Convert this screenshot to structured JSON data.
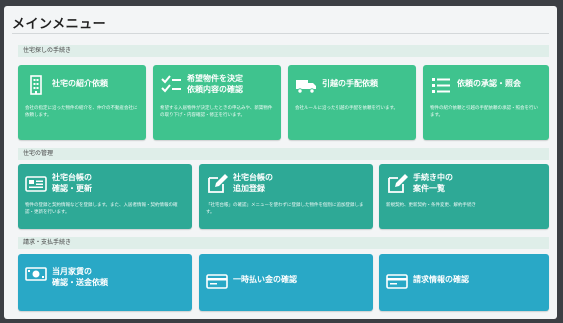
{
  "page": {
    "title": "メインメニュー"
  },
  "sections": [
    {
      "header": "住宅探しの手続き",
      "cards": [
        {
          "title": "社宅の紹介依頼",
          "description": "会社の指定に沿った物件の紹介を、仲介の不動産会社に依頼します。",
          "icon": "building-icon"
        },
        {
          "title": "希望物件を決定\n依頼内容の確認",
          "description": "希望する入居物件が決定したときの申込みや、新築物件の取り下げ・内容確認・修正を行います。",
          "icon": "checklist-icon"
        },
        {
          "title": "引越の手配依頼",
          "description": "会社ルールに沿った引越の手配を依頼を行います。",
          "icon": "truck-icon"
        },
        {
          "title": "依頼の承認・照会",
          "description": "物件の紹介依頼と引越の手配依頼の承認・照会を行います。",
          "icon": "list-icon"
        }
      ]
    },
    {
      "header": "住宅の管理",
      "cards": [
        {
          "title": "社宅台帳の\n確認・更新",
          "description": "物件の登録と契約情報などを登録します。また、入居者情報・契約情報の確認・更新を行います。",
          "icon": "ledger-icon"
        },
        {
          "title": "社宅台帳の\n追加登録",
          "description": "「社宅台帳」の確認」メニューを使わずに登録した物件を個別に追加登録します。",
          "icon": "edit-icon"
        },
        {
          "title": "手続き中の\n案件一覧",
          "description": "新規契約、更新契約・条件変更、解約手続き",
          "icon": "edit-icon"
        }
      ]
    },
    {
      "header": "請求・支払手続き",
      "cards": [
        {
          "title": "当月家賃の\n確認・送金依頼",
          "description": "",
          "icon": "money-icon"
        },
        {
          "title": "一時払い金の確認",
          "description": "",
          "icon": "card-icon"
        },
        {
          "title": "請求情報の確認",
          "description": "",
          "icon": "card-icon"
        }
      ]
    }
  ],
  "colors": {
    "green": "#3fc38e",
    "teal": "#2ea996",
    "blue": "#29a8c6"
  }
}
